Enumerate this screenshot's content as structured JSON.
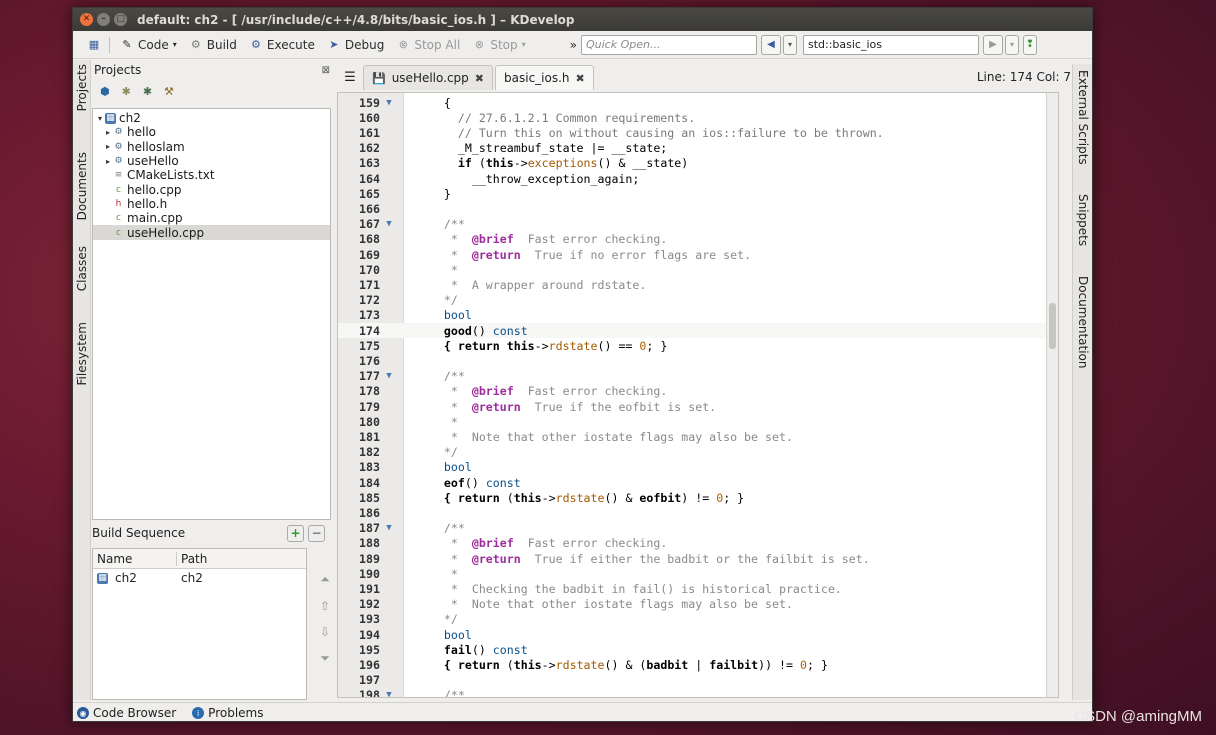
{
  "window": {
    "title": "default:  ch2 - [ /usr/include/c++/4.8/bits/basic_ios.h ] – KDevelop"
  },
  "toolbar": {
    "code": "Code",
    "build": "Build",
    "execute": "Execute",
    "debug": "Debug",
    "stop_all": "Stop All",
    "stop": "Stop",
    "quick_open_placeholder": "Quick Open...",
    "context": "std::basic_ios"
  },
  "left_tabs": [
    "Projects",
    "Documents",
    "Classes",
    "Filesystem"
  ],
  "projects": {
    "title": "Projects",
    "tree": [
      {
        "label": "ch2",
        "level": 0,
        "arrow": "▾",
        "icon": "project-icon",
        "selected": false
      },
      {
        "label": "hello",
        "level": 1,
        "arrow": "▸",
        "icon": "target-icon",
        "selected": false
      },
      {
        "label": "helloslam",
        "level": 1,
        "arrow": "▸",
        "icon": "target-icon",
        "selected": false
      },
      {
        "label": "useHello",
        "level": 1,
        "arrow": "▸",
        "icon": "target-icon",
        "selected": false
      },
      {
        "label": "CMakeLists.txt",
        "level": 1,
        "arrow": "",
        "icon": "text-file-icon",
        "selected": false
      },
      {
        "label": "hello.cpp",
        "level": 1,
        "arrow": "",
        "icon": "cpp-file-icon",
        "selected": false
      },
      {
        "label": "hello.h",
        "level": 1,
        "arrow": "",
        "icon": "header-file-icon",
        "selected": false
      },
      {
        "label": "main.cpp",
        "level": 1,
        "arrow": "",
        "icon": "cpp-file-icon",
        "selected": false
      },
      {
        "label": "useHello.cpp",
        "level": 1,
        "arrow": "",
        "icon": "cpp-file-icon",
        "selected": true
      }
    ]
  },
  "build_sequence": {
    "title": "Build Sequence",
    "columns": [
      "Name",
      "Path"
    ],
    "rows": [
      {
        "name": "ch2",
        "path": "ch2"
      }
    ]
  },
  "editor": {
    "tabs": [
      {
        "label": "useHello.cpp",
        "active": false
      },
      {
        "label": "basic_ios.h",
        "active": true
      }
    ],
    "position": "Line: 174 Col: 7",
    "current_line": 174,
    "lines": [
      {
        "n": "159",
        "fold": "▼",
        "seg": [
          [
            "op",
            "    {"
          ]
        ]
      },
      {
        "n": "160",
        "fold": "",
        "seg": [
          [
            "comment",
            "      // 27.6.1.2.1 Common requirements."
          ]
        ]
      },
      {
        "n": "161",
        "fold": "",
        "seg": [
          [
            "comment",
            "      // Turn this on without causing an ios::failure to be thrown."
          ]
        ]
      },
      {
        "n": "162",
        "fold": "",
        "seg": [
          [
            "op",
            "      _M_streambuf_state |= __state;"
          ]
        ]
      },
      {
        "n": "163",
        "fold": "",
        "seg": [
          [
            "kw",
            "      if "
          ],
          [
            "op",
            "("
          ],
          [
            "kw",
            "this"
          ],
          [
            "op",
            "->"
          ],
          [
            "fn",
            "exceptions"
          ],
          [
            "op",
            "() & __state)"
          ]
        ]
      },
      {
        "n": "164",
        "fold": "",
        "seg": [
          [
            "op",
            "        __throw_exception_again;"
          ]
        ]
      },
      {
        "n": "165",
        "fold": "",
        "seg": [
          [
            "op",
            "    }"
          ]
        ]
      },
      {
        "n": "166",
        "fold": "",
        "seg": [
          [
            "op",
            ""
          ]
        ]
      },
      {
        "n": "167",
        "fold": "▼",
        "seg": [
          [
            "doc",
            "    /**"
          ]
        ]
      },
      {
        "n": "168",
        "fold": "",
        "seg": [
          [
            "doc",
            "     *  "
          ],
          [
            "tag",
            "@brief"
          ],
          [
            "doc",
            "  Fast error checking."
          ]
        ]
      },
      {
        "n": "169",
        "fold": "",
        "seg": [
          [
            "doc",
            "     *  "
          ],
          [
            "tag",
            "@return"
          ],
          [
            "doc",
            "  True if no error flags are set."
          ]
        ]
      },
      {
        "n": "170",
        "fold": "",
        "seg": [
          [
            "doc",
            "     *"
          ]
        ]
      },
      {
        "n": "171",
        "fold": "",
        "seg": [
          [
            "doc",
            "     *  A wrapper around rdstate."
          ]
        ]
      },
      {
        "n": "172",
        "fold": "",
        "seg": [
          [
            "doc",
            "    */"
          ]
        ]
      },
      {
        "n": "173",
        "fold": "",
        "seg": [
          [
            "type",
            "    bool"
          ]
        ]
      },
      {
        "n": "174",
        "fold": "",
        "seg": [
          [
            "kw",
            "    good"
          ],
          [
            "op",
            "() "
          ],
          [
            "type",
            "const"
          ]
        ]
      },
      {
        "n": "175",
        "fold": "",
        "seg": [
          [
            "kw",
            "    { return this"
          ],
          [
            "op",
            "->"
          ],
          [
            "fn",
            "rdstate"
          ],
          [
            "op",
            "() == "
          ],
          [
            "num",
            "0"
          ],
          [
            "op",
            "; }"
          ]
        ]
      },
      {
        "n": "176",
        "fold": "",
        "seg": [
          [
            "op",
            ""
          ]
        ]
      },
      {
        "n": "177",
        "fold": "▼",
        "seg": [
          [
            "doc",
            "    /**"
          ]
        ]
      },
      {
        "n": "178",
        "fold": "",
        "seg": [
          [
            "doc",
            "     *  "
          ],
          [
            "tag",
            "@brief"
          ],
          [
            "doc",
            "  Fast error checking."
          ]
        ]
      },
      {
        "n": "179",
        "fold": "",
        "seg": [
          [
            "doc",
            "     *  "
          ],
          [
            "tag",
            "@return"
          ],
          [
            "doc",
            "  True if the eofbit is set."
          ]
        ]
      },
      {
        "n": "180",
        "fold": "",
        "seg": [
          [
            "doc",
            "     *"
          ]
        ]
      },
      {
        "n": "181",
        "fold": "",
        "seg": [
          [
            "doc",
            "     *  Note that other iostate flags may also be set."
          ]
        ]
      },
      {
        "n": "182",
        "fold": "",
        "seg": [
          [
            "doc",
            "    */"
          ]
        ]
      },
      {
        "n": "183",
        "fold": "",
        "seg": [
          [
            "type",
            "    bool"
          ]
        ]
      },
      {
        "n": "184",
        "fold": "",
        "seg": [
          [
            "kw",
            "    eof"
          ],
          [
            "op",
            "() "
          ],
          [
            "type",
            "const"
          ]
        ]
      },
      {
        "n": "185",
        "fold": "",
        "seg": [
          [
            "kw",
            "    { return "
          ],
          [
            "op",
            "("
          ],
          [
            "kw",
            "this"
          ],
          [
            "op",
            "->"
          ],
          [
            "fn",
            "rdstate"
          ],
          [
            "op",
            "() & "
          ],
          [
            "kw",
            "eofbit"
          ],
          [
            "op",
            ") != "
          ],
          [
            "num",
            "0"
          ],
          [
            "op",
            "; }"
          ]
        ]
      },
      {
        "n": "186",
        "fold": "",
        "seg": [
          [
            "op",
            ""
          ]
        ]
      },
      {
        "n": "187",
        "fold": "▼",
        "seg": [
          [
            "doc",
            "    /**"
          ]
        ]
      },
      {
        "n": "188",
        "fold": "",
        "seg": [
          [
            "doc",
            "     *  "
          ],
          [
            "tag",
            "@brief"
          ],
          [
            "doc",
            "  Fast error checking."
          ]
        ]
      },
      {
        "n": "189",
        "fold": "",
        "seg": [
          [
            "doc",
            "     *  "
          ],
          [
            "tag",
            "@return"
          ],
          [
            "doc",
            "  True if either the badbit or the failbit is set."
          ]
        ]
      },
      {
        "n": "190",
        "fold": "",
        "seg": [
          [
            "doc",
            "     *"
          ]
        ]
      },
      {
        "n": "191",
        "fold": "",
        "seg": [
          [
            "doc",
            "     *  Checking the badbit in fail() is historical practice."
          ]
        ]
      },
      {
        "n": "192",
        "fold": "",
        "seg": [
          [
            "doc",
            "     *  Note that other iostate flags may also be set."
          ]
        ]
      },
      {
        "n": "193",
        "fold": "",
        "seg": [
          [
            "doc",
            "    */"
          ]
        ]
      },
      {
        "n": "194",
        "fold": "",
        "seg": [
          [
            "type",
            "    bool"
          ]
        ]
      },
      {
        "n": "195",
        "fold": "",
        "seg": [
          [
            "kw",
            "    fail"
          ],
          [
            "op",
            "() "
          ],
          [
            "type",
            "const"
          ]
        ]
      },
      {
        "n": "196",
        "fold": "",
        "seg": [
          [
            "kw",
            "    { return "
          ],
          [
            "op",
            "("
          ],
          [
            "kw",
            "this"
          ],
          [
            "op",
            "->"
          ],
          [
            "fn",
            "rdstate"
          ],
          [
            "op",
            "() & ("
          ],
          [
            "kw",
            "badbit"
          ],
          [
            "op",
            " | "
          ],
          [
            "kw",
            "failbit"
          ],
          [
            "op",
            ")) != "
          ],
          [
            "num",
            "0"
          ],
          [
            "op",
            "; }"
          ]
        ]
      },
      {
        "n": "197",
        "fold": "",
        "seg": [
          [
            "op",
            ""
          ]
        ]
      },
      {
        "n": "198",
        "fold": "▼",
        "seg": [
          [
            "doc",
            "    /**"
          ]
        ]
      }
    ]
  },
  "right_tabs": [
    "External Scripts",
    "Snippets",
    "Documentation"
  ],
  "statusbar": {
    "code_browser": "Code Browser",
    "problems": "Problems"
  },
  "watermark": "CSDN @amingMM"
}
